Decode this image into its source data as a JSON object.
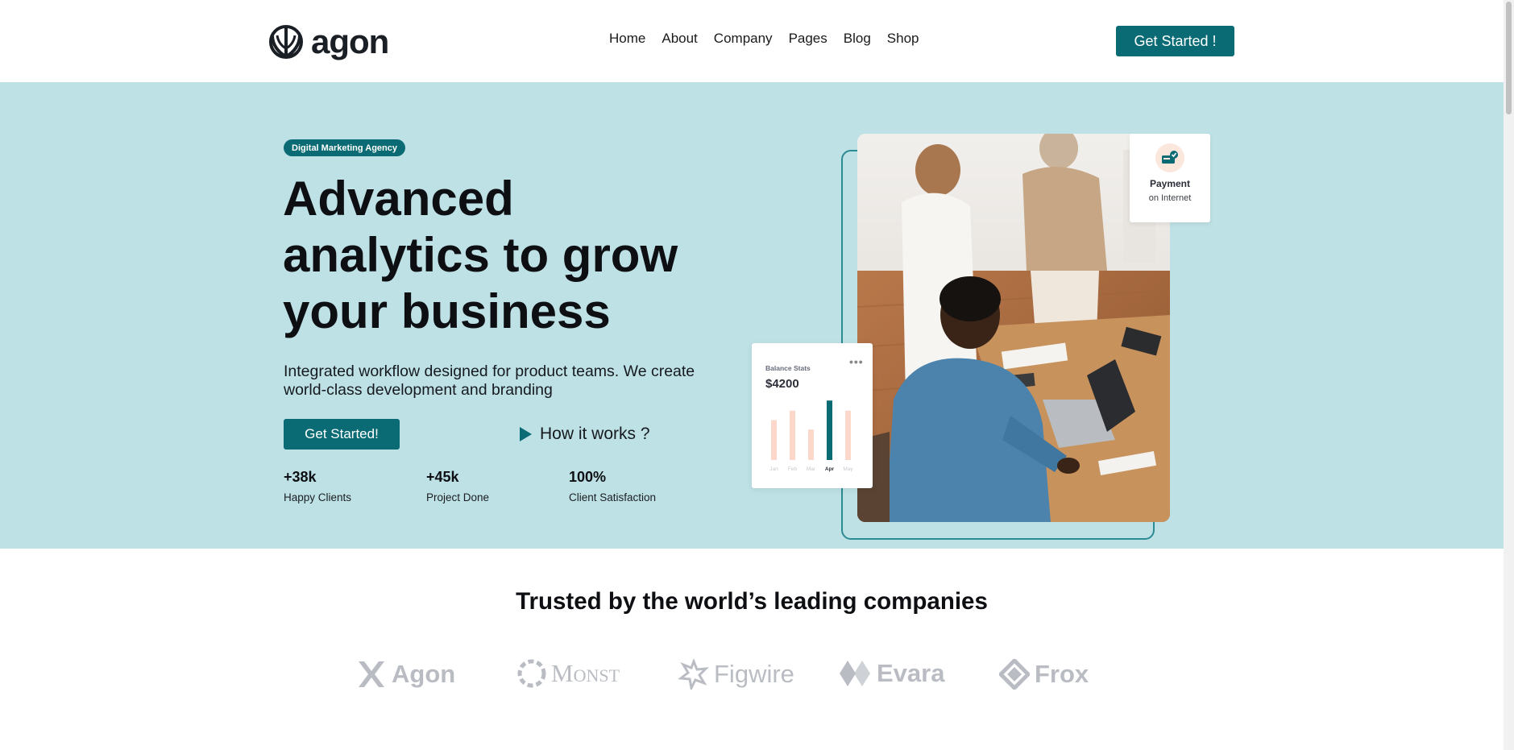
{
  "header": {
    "logo_text": "agon",
    "nav": [
      "Home",
      "About",
      "Company",
      "Pages",
      "Blog",
      "Shop"
    ],
    "cta_label": "Get Started !"
  },
  "hero": {
    "badge": "Digital Marketing Agency",
    "title": "Advanced analytics to grow your business",
    "description": "Integrated workflow designed for product teams. We create world-class development and branding",
    "cta_label": "Get Started!",
    "secondary_label": "How it works ?",
    "stats": [
      {
        "value": "+38k",
        "label": "Happy Clients"
      },
      {
        "value": "+45k",
        "label": "Project Done"
      },
      {
        "value": "100%",
        "label": "Client Satisfaction"
      }
    ],
    "payment_card": {
      "title": "Payment",
      "subtitle": "on Internet"
    },
    "balance_card": {
      "title": "Balance Stats",
      "value": "$4200",
      "months": [
        "Jan",
        "Feb",
        "Mar",
        "Apr",
        "May"
      ],
      "bar_levels": [
        0.55,
        0.68,
        0.42,
        0.82,
        0.68
      ],
      "highlight_index": 3
    }
  },
  "trusted": {
    "title": "Trusted by the world’s leading companies",
    "logos": [
      "Agon",
      "Monst",
      "Figwire",
      "Evara",
      "Frox"
    ]
  },
  "colors": {
    "brand": "#0a6b74",
    "hero_bg": "#bee1e6",
    "bar_light": "#fcd8cb",
    "logo_gray": "#b9bdc3"
  }
}
